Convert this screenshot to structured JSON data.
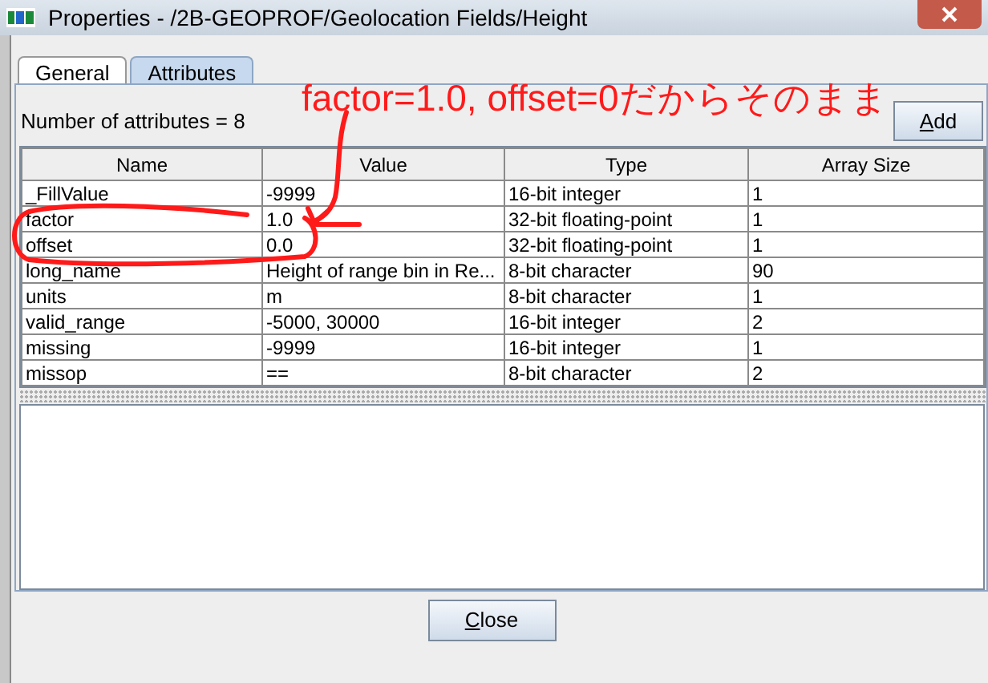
{
  "window": {
    "title": "Properties - /2B-GEOPROF/Geolocation Fields/Height"
  },
  "tabs": [
    {
      "label": "General",
      "selected": false
    },
    {
      "label": "Attributes",
      "selected": true
    }
  ],
  "attribute_count": "Number of attributes = 8",
  "add_button": "Add",
  "table": {
    "columns": [
      "Name",
      "Value",
      "Type",
      "Array Size"
    ],
    "rows": [
      [
        "_FillValue",
        "-9999",
        "16-bit integer",
        "1"
      ],
      [
        "factor",
        "1.0",
        "32-bit floating-point",
        "1"
      ],
      [
        "offset",
        "0.0",
        "32-bit floating-point",
        "1"
      ],
      [
        "long_name",
        "Height of range bin in Re...",
        "8-bit character",
        "90"
      ],
      [
        "units",
        "m",
        "8-bit character",
        "1"
      ],
      [
        "valid_range",
        "-5000, 30000",
        "16-bit integer",
        "2"
      ],
      [
        "missing",
        "-9999",
        "16-bit integer",
        "1"
      ],
      [
        "missop",
        "==",
        "8-bit character",
        "2"
      ]
    ]
  },
  "annotation": {
    "text": "factor=1.0, offset=0だからそのまま"
  },
  "close_button": "Close"
}
